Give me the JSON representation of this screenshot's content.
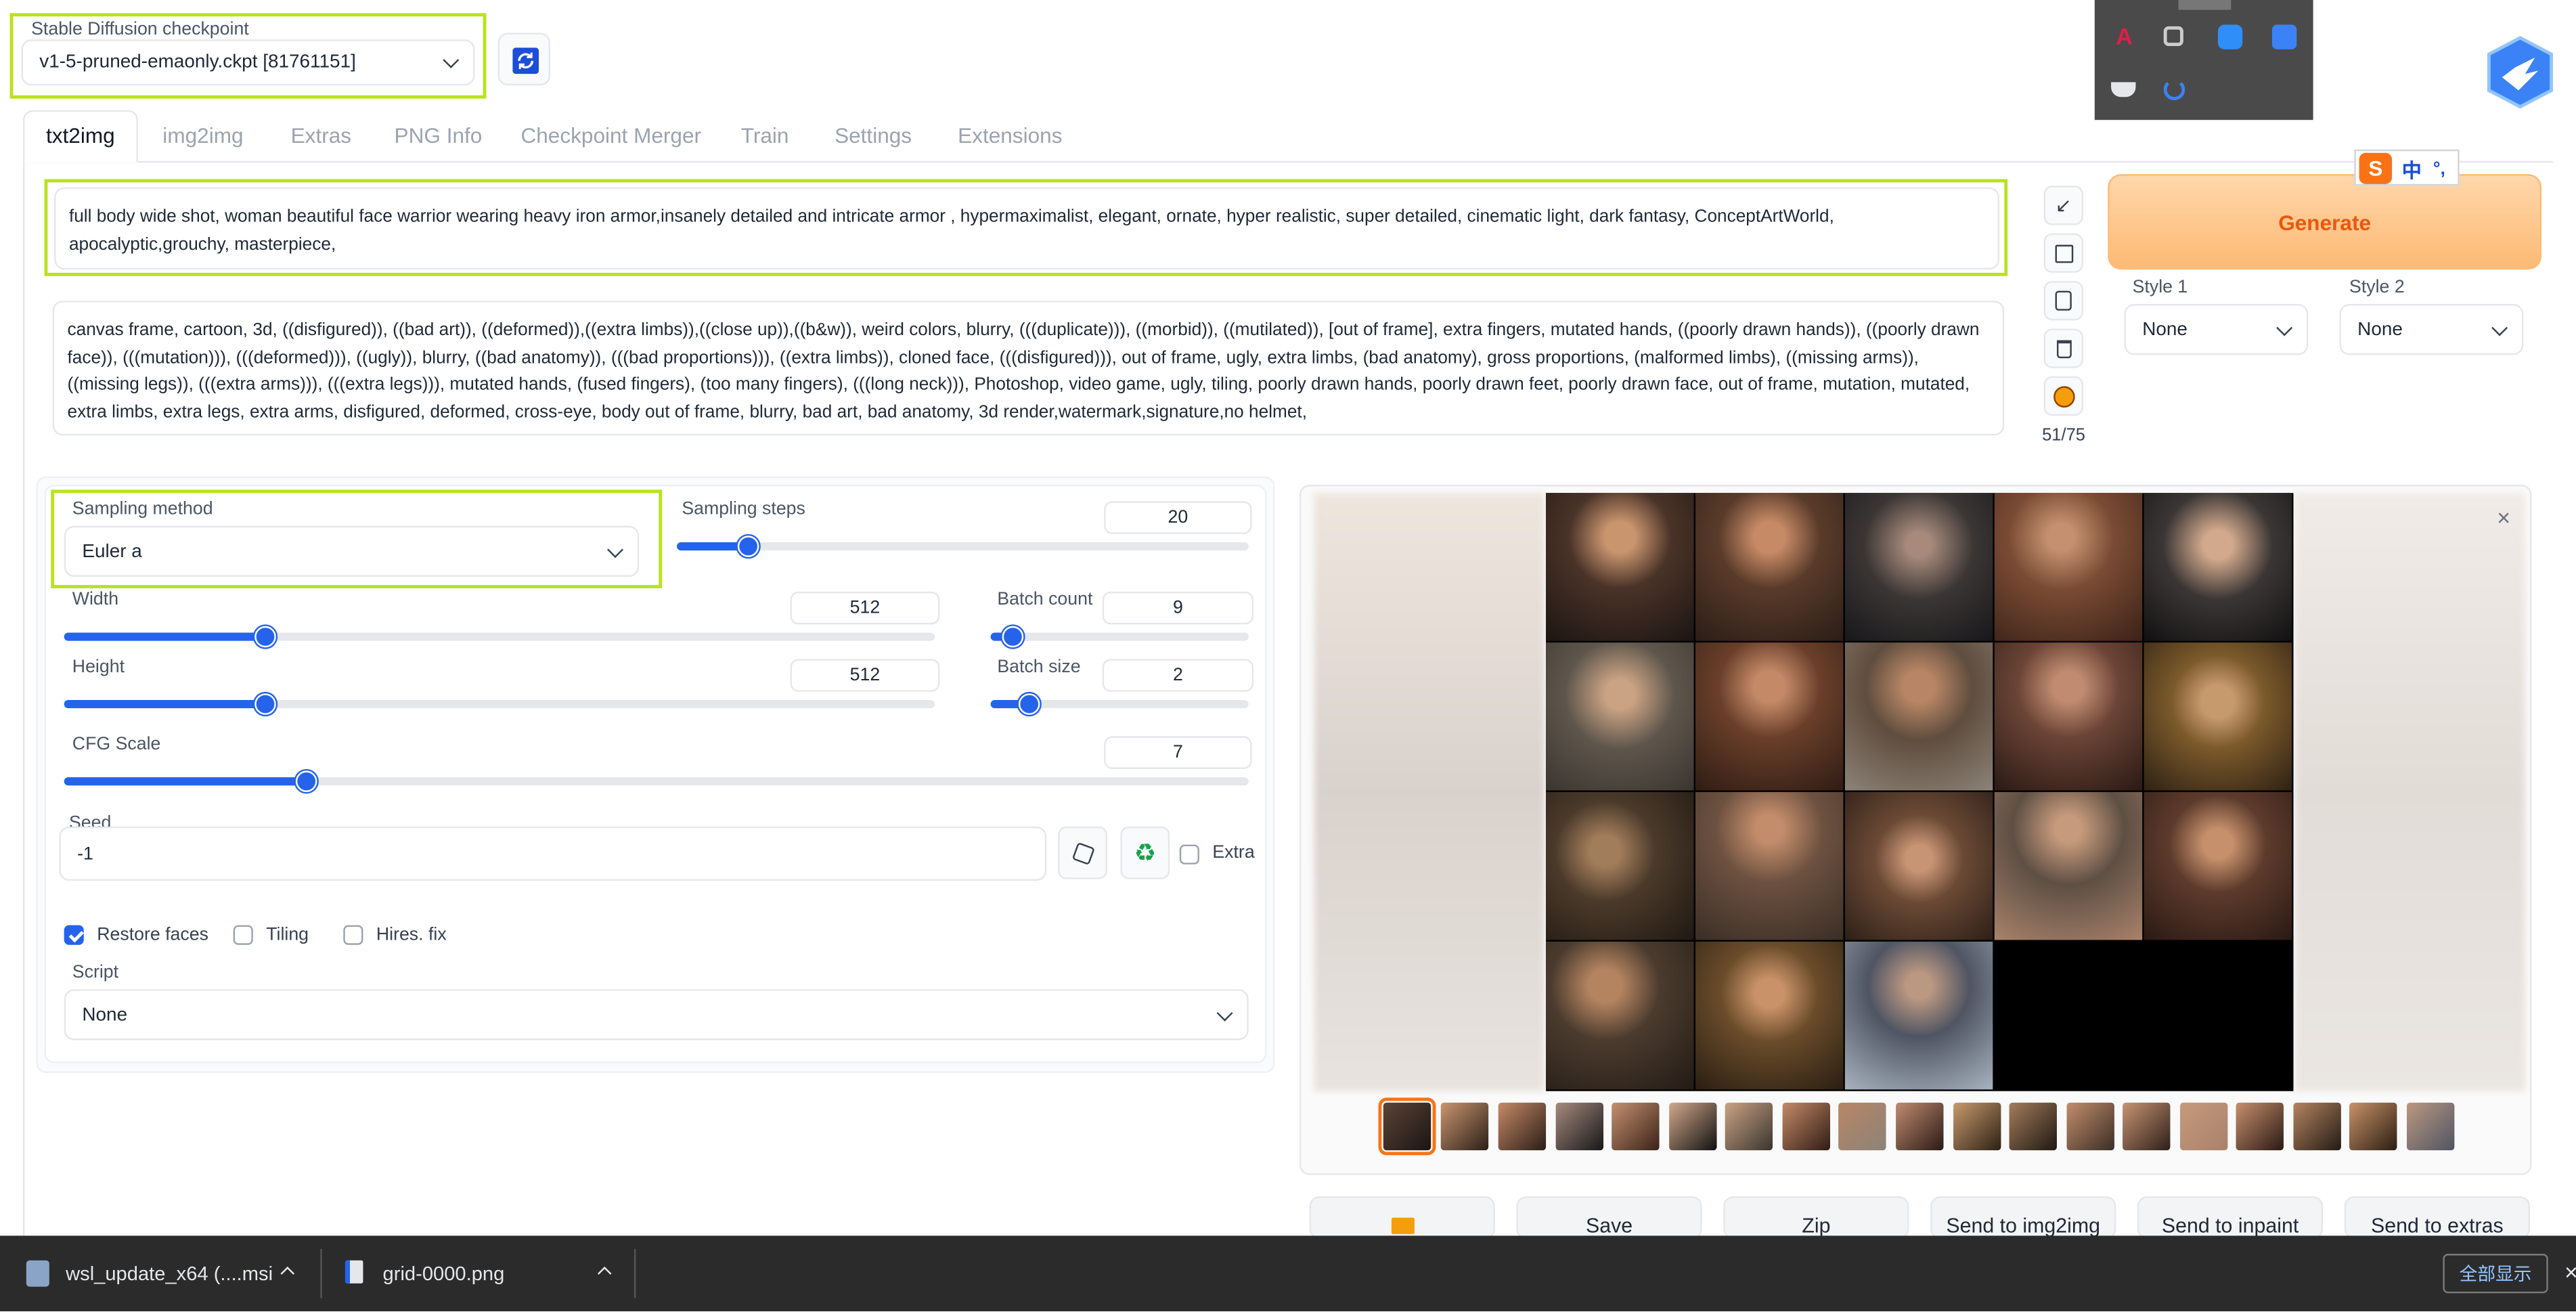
{
  "checkpoint": {
    "label": "Stable Diffusion checkpoint",
    "value": "v1-5-pruned-emaonly.ckpt [81761151]"
  },
  "tabs": [
    "txt2img",
    "img2img",
    "Extras",
    "PNG Info",
    "Checkpoint Merger",
    "Train",
    "Settings",
    "Extensions"
  ],
  "prompt": {
    "positive": "full body wide shot, woman beautiful face warrior wearing heavy iron armor,insanely detailed and intricate armor , hypermaximalist, elegant, ornate, hyper realistic, super detailed, cinematic light, dark fantasy, ConceptArtWorld, apocalyptic,grouchy, masterpiece,",
    "negative": "canvas frame, cartoon, 3d, ((disfigured)), ((bad art)), ((deformed)),((extra limbs)),((close up)),((b&w)), weird colors, blurry, (((duplicate))), ((morbid)), ((mutilated)), [out of frame], extra fingers, mutated hands, ((poorly drawn hands)), ((poorly drawn face)), (((mutation))), (((deformed))), ((ugly)), blurry, ((bad anatomy)), (((bad proportions))), ((extra limbs)), cloned face, (((disfigured))), out of frame, ugly, extra limbs, (bad anatomy), gross proportions, (malformed limbs), ((missing arms)), ((missing legs)), (((extra arms))), (((extra legs))), mutated hands, (fused fingers), (too many fingers), (((long neck))), Photoshop, video game, ugly, tiling, poorly drawn hands, poorly drawn feet, poorly drawn face, out of frame, mutation, mutated, extra limbs, extra legs, extra arms, disfigured, deformed, cross-eye, body out of frame, blurry, bad art, bad anatomy, 3d render,watermark,signature,no helmet,",
    "token_count": "51/75"
  },
  "generate_label": "Generate",
  "styles": {
    "style1_label": "Style 1",
    "style1_value": "None",
    "style2_label": "Style 2",
    "style2_value": "None"
  },
  "params": {
    "sampling_method_label": "Sampling method",
    "sampling_method": "Euler a",
    "steps_label": "Sampling steps",
    "steps": "20",
    "steps_fraction": 0.1237,
    "width_label": "Width",
    "width": "512",
    "width_fraction": 0.2299,
    "height_label": "Height",
    "height": "512",
    "height_fraction": 0.2299,
    "batch_count_label": "Batch count",
    "batch_count": "9",
    "batch_count_fraction": 0.0851,
    "batch_size_label": "Batch size",
    "batch_size": "2",
    "batch_size_fraction": 0.1468,
    "cfg_label": "CFG Scale",
    "cfg": "7",
    "cfg_fraction": 0.2032,
    "seed_label": "Seed",
    "seed": "-1",
    "extra_label": "Extra",
    "restore_faces_label": "Restore faces",
    "restore_faces": true,
    "tiling_label": "Tiling",
    "tiling": false,
    "hires_label": "Hires. fix",
    "hires": false,
    "script_label": "Script",
    "script": "None"
  },
  "output_buttons": [
    "",
    "Save",
    "Zip",
    "Send to img2img",
    "Send to inpaint",
    "Send to extras"
  ],
  "ime": {
    "lang": "中"
  },
  "taskbar": {
    "download1": "wsl_update_x64 (....msi",
    "download2": "grid-0000.png",
    "show_all": "全部显示"
  },
  "colors": {
    "accent": "#2563eb",
    "highlight": "#b9e31c",
    "generate_bg": "#fdba74",
    "generate_text": "#ea580c",
    "taskbar_bg": "#2b2b2b"
  }
}
